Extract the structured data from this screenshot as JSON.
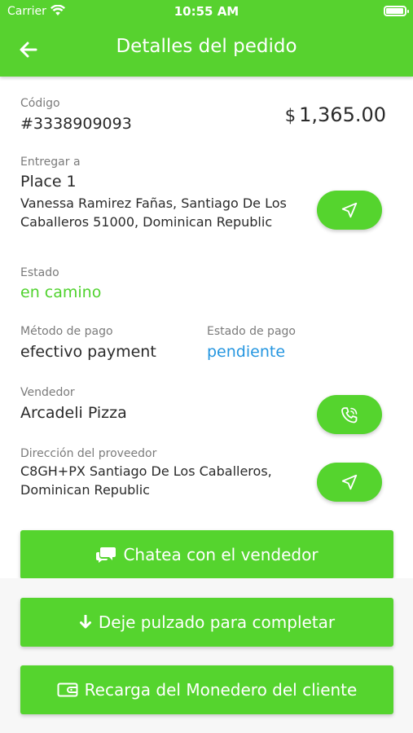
{
  "status_bar": {
    "carrier": "Carrier",
    "time": "10:55 AM"
  },
  "header": {
    "title": "Detalles del pedido"
  },
  "order": {
    "code_label": "Código",
    "code_value": "#3338909093",
    "currency_symbol": "$",
    "amount": "1,365.00"
  },
  "delivery": {
    "label": "Entregar a",
    "place": "Place 1",
    "address_line1": "Vanessa Ramirez Fañas, Santiago De Los",
    "address_line2": "Caballeros 51000, Dominican Republic"
  },
  "state": {
    "label": "Estado",
    "value": "en camino"
  },
  "payment": {
    "method_label": "Método de pago",
    "method_value": "efectivo payment",
    "status_label": "Estado de pago",
    "status_value": "pendiente"
  },
  "vendor": {
    "label": "Vendedor",
    "value": "Arcadeli Pizza"
  },
  "provider": {
    "label": "Dirección del proveedor",
    "address_line1": "C8GH+PX Santiago De Los Caballeros,",
    "address_line2": "Dominican Republic"
  },
  "buttons": {
    "chat": "Chatea con el vendedor",
    "complete": "Deje pulzado para completar",
    "wallet": "Recarga del Monedero del cliente"
  },
  "colors": {
    "brand_green": "#57d22f",
    "status_green": "#4fd22d",
    "link_blue": "#2596e0"
  }
}
